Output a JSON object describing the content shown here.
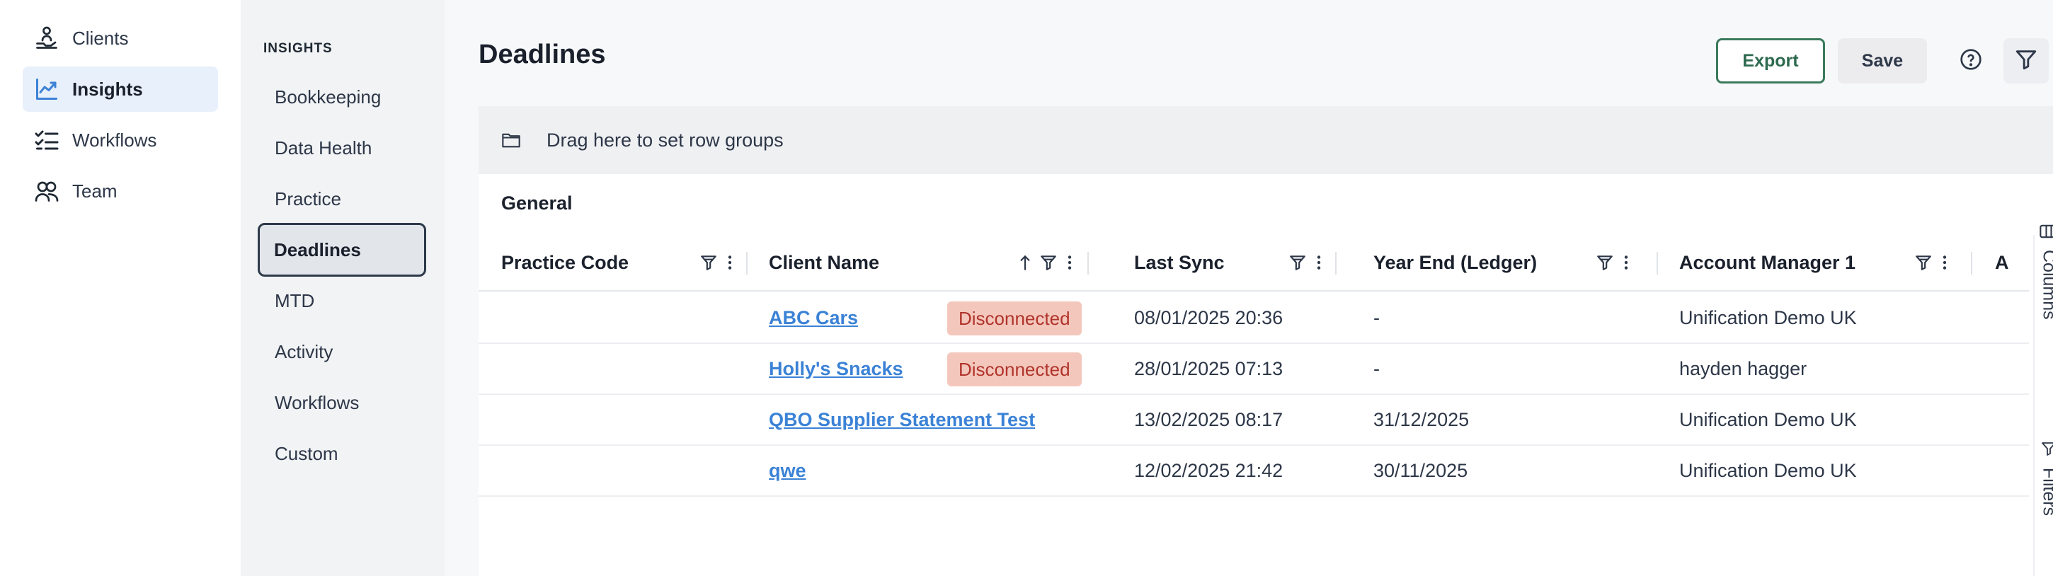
{
  "nav": {
    "items": [
      {
        "label": "Clients",
        "icon": "clients-icon"
      },
      {
        "label": "Insights",
        "icon": "chart-line-icon"
      },
      {
        "label": "Workflows",
        "icon": "checklist-icon"
      },
      {
        "label": "Team",
        "icon": "team-icon"
      }
    ],
    "active": "Insights"
  },
  "subnav": {
    "heading": "INSIGHTS",
    "items": [
      "Bookkeeping",
      "Data Health",
      "Practice",
      "Deadlines",
      "MTD",
      "Activity",
      "Workflows",
      "Custom"
    ],
    "active": "Deadlines"
  },
  "page": {
    "title": "Deadlines",
    "export_label": "Export",
    "save_label": "Save"
  },
  "grid": {
    "group_bar_text": "Drag here to set row groups",
    "column_group": "General",
    "columns": [
      "Practice Code",
      "Client Name",
      "Last Sync",
      "Year End (Ledger)",
      "Account Manager 1",
      "A"
    ],
    "rows": [
      {
        "practice_code": "",
        "client_name": "ABC Cars",
        "status": "Disconnected",
        "last_sync": "08/01/2025 20:36",
        "year_end": "-",
        "account_manager": "Unification Demo UK"
      },
      {
        "practice_code": "",
        "client_name": "Holly's Snacks",
        "status": "Disconnected",
        "last_sync": "28/01/2025 07:13",
        "year_end": "-",
        "account_manager": "hayden hagger"
      },
      {
        "practice_code": "",
        "client_name": "QBO Supplier Statement Test",
        "status": "",
        "last_sync": "13/02/2025 08:17",
        "year_end": "31/12/2025",
        "account_manager": "Unification Demo UK"
      },
      {
        "practice_code": "",
        "client_name": "qwe",
        "status": "",
        "last_sync": "12/02/2025 21:42",
        "year_end": "30/11/2025",
        "account_manager": "Unification Demo UK"
      }
    ],
    "side_tabs": {
      "columns": "Columns",
      "filters": "Filters"
    }
  },
  "colors": {
    "accent": "#3b82d6",
    "export_border": "#3b7a5c",
    "badge_bg": "#f4c7bc",
    "badge_text": "#b0342b",
    "active_nav_bg": "#e8f0fb"
  }
}
